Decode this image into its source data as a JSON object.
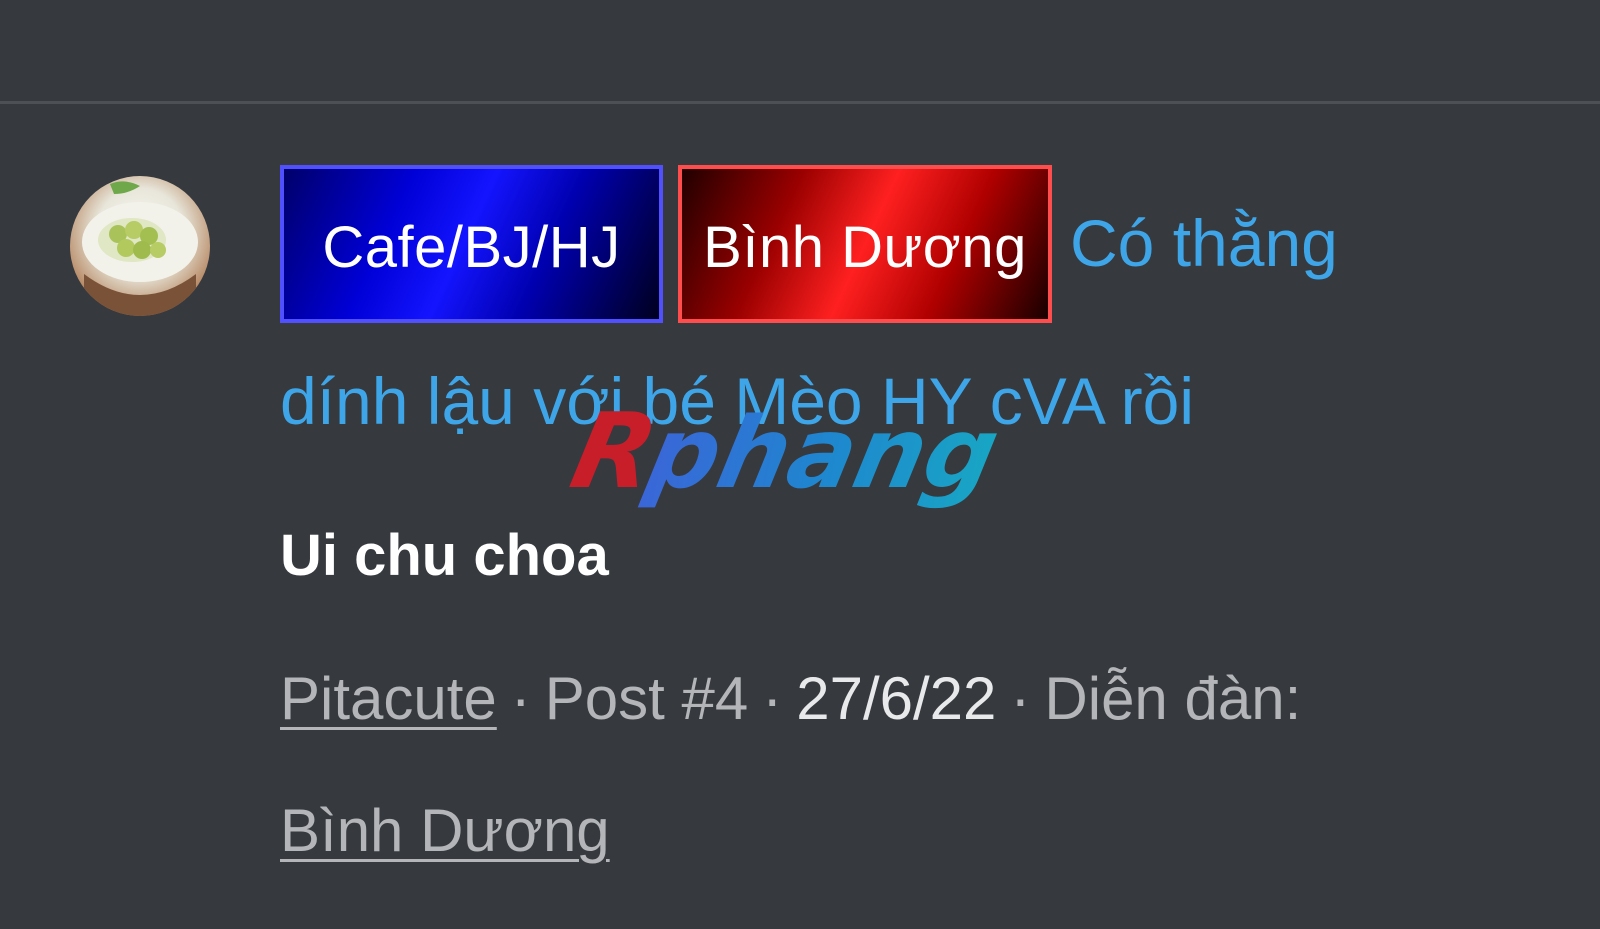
{
  "thread": {
    "prefixes": [
      {
        "label": "Cafe/BJ/HJ",
        "color": "#1414ff"
      },
      {
        "label": "Bình Dương",
        "color": "#ff2020"
      }
    ],
    "title_line_1": "Có thằng",
    "title_line_2": "dính lậu với bé Mèo HY cVA rồi",
    "title_color": "#3ea6e8",
    "snippet": "Ui chu choa",
    "meta": {
      "author": "Pitacute",
      "separator": "·",
      "post": "Post #4",
      "date": "27/6/22",
      "forum_label": "Diễn đàn:",
      "forum": "Bình Dương"
    }
  },
  "watermark": {
    "text": "Rphang"
  },
  "colors": {
    "background": "#36393e",
    "divider": "#4d5156",
    "meta_text": "#b3b5b8"
  },
  "icons": {
    "avatar": "avatar-image"
  }
}
